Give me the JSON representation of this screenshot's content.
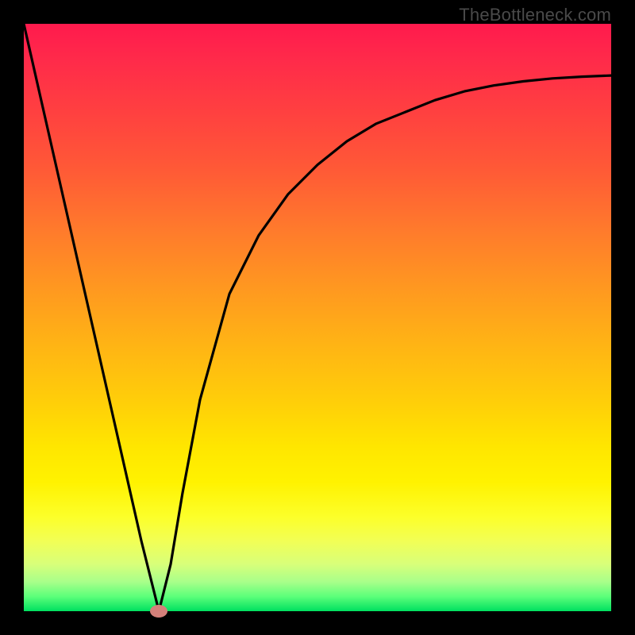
{
  "watermark": "TheBottleneck.com",
  "chart_data": {
    "type": "line",
    "title": "",
    "xlabel": "",
    "ylabel": "",
    "xlim": [
      0,
      100
    ],
    "ylim": [
      0,
      100
    ],
    "grid": false,
    "legend": false,
    "series": [
      {
        "name": "curve",
        "x": [
          0,
          5,
          10,
          15,
          20,
          23,
          25,
          27,
          30,
          35,
          40,
          45,
          50,
          55,
          60,
          65,
          70,
          75,
          80,
          85,
          90,
          95,
          100
        ],
        "y": [
          100,
          78,
          56,
          34,
          12,
          0,
          8,
          20,
          36,
          54,
          64,
          71,
          76,
          80,
          83,
          85,
          87,
          88.5,
          89.5,
          90.2,
          90.7,
          91,
          91.2
        ]
      }
    ],
    "marker": {
      "x": 23,
      "y": 0
    },
    "background_gradient": {
      "stops": [
        {
          "pos": 0,
          "color": "#ff1a4d"
        },
        {
          "pos": 0.5,
          "color": "#ffb514"
        },
        {
          "pos": 0.8,
          "color": "#fff200"
        },
        {
          "pos": 1.0,
          "color": "#00e060"
        }
      ]
    }
  }
}
